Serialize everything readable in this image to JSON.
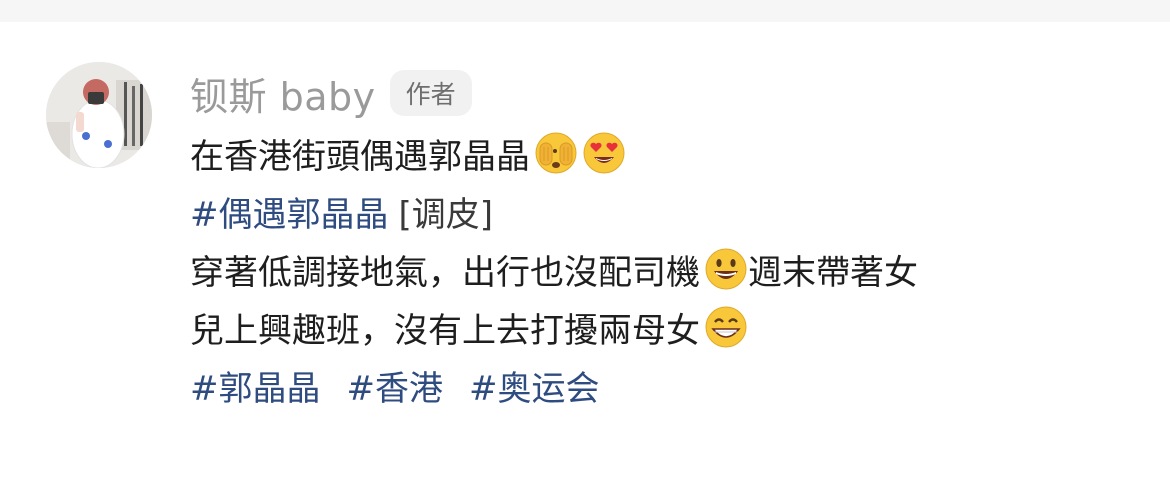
{
  "comment": {
    "username": "钡斯 baby",
    "author_badge": "作者",
    "line1_text": "在香港街頭偶遇郭晶晶",
    "line1_emojis": [
      "face-with-peeking-eye-emoji",
      "heart-eyes-emoji"
    ],
    "line2_tag": "#偶遇郭晶晶",
    "line2_sticker": "[调皮]",
    "line3_text_a": "穿著低調接地氣，出行也沒配司機",
    "line3_text_b": "週末帶著女",
    "line4_text": "兒上興趣班，沒有上去打擾兩母女",
    "line3_emoji": "smiling-face-open-mouth-emoji",
    "line4_emoji": "grinning-face-emoji",
    "hashtags": [
      "#郭晶晶",
      "#香港",
      "#奥运会"
    ]
  },
  "colors": {
    "hashtag": "#2f4c80",
    "username": "#9a9a9a",
    "text": "#1e1e1e",
    "badge_bg": "#f1f1f1"
  }
}
